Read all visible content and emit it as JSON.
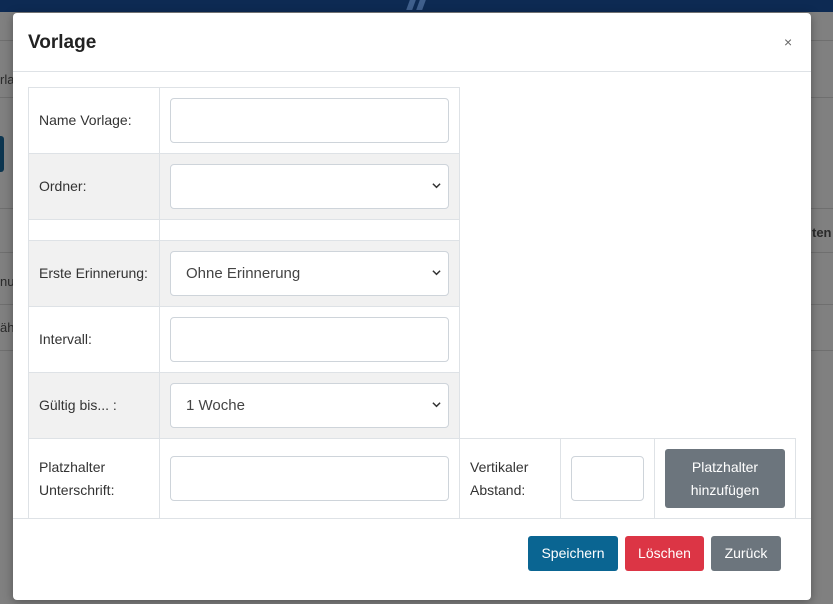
{
  "background": {
    "fragments": [
      "rla",
      "ten",
      "nu",
      "äh"
    ]
  },
  "modal": {
    "title": "Vorlage",
    "close_label": "×"
  },
  "form": {
    "name_label": "Name Vorlage:",
    "name_value": "",
    "folder_label": "Ordner:",
    "folder_value": "",
    "first_reminder_label": "Erste Erinnerung:",
    "first_reminder_value": "Ohne Erinnerung",
    "interval_label": "Intervall:",
    "interval_value": "",
    "valid_until_label": "Gültig bis... :",
    "valid_until_value": "1 Woche",
    "placeholder_signature_label": "Platzhalter Unterschrift:",
    "placeholder_signature_value": "",
    "vertical_spacing_label": "Vertikaler Abstand:",
    "vertical_spacing_value": "",
    "add_placeholder_label": "Platzhalter hinzufügen"
  },
  "footer": {
    "save_label": "Speichern",
    "delete_label": "Löschen",
    "back_label": "Zurück"
  },
  "colors": {
    "save": "#0a6592",
    "delete": "#dc3545",
    "back": "#6c757d",
    "topbar": "#0d2a53"
  }
}
